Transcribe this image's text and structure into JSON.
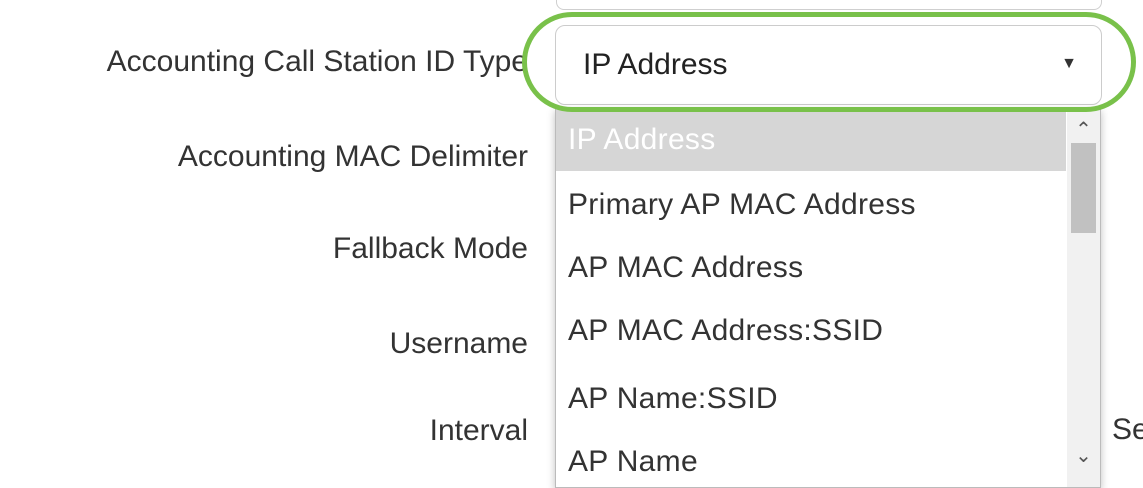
{
  "form": {
    "labels": {
      "call_station_id_type": "Accounting Call Station ID Type",
      "mac_delimiter": "Accounting MAC Delimiter",
      "fallback_mode": "Fallback Mode",
      "username": "Username",
      "interval": "Interval"
    },
    "interval_unit_partial": "Se"
  },
  "select": {
    "value": "IP Address",
    "caret_icon": "caret-down-icon",
    "caret_glyph": "▼"
  },
  "dropdown": {
    "options": [
      {
        "label": "IP Address",
        "selected": true
      },
      {
        "label": "Primary AP MAC Address",
        "selected": false
      },
      {
        "label": "AP MAC Address",
        "selected": false
      },
      {
        "label": "AP MAC Address:SSID",
        "selected": false
      },
      {
        "label": "AP Name:SSID",
        "selected": false
      },
      {
        "label": "AP Name",
        "selected": false
      }
    ],
    "scroll_up_glyph": "⌃",
    "scroll_down_glyph": "⌄"
  },
  "colors": {
    "highlight_ring": "#79c14a",
    "selected_option_bg": "#d6d6d6",
    "text": "#333333"
  }
}
